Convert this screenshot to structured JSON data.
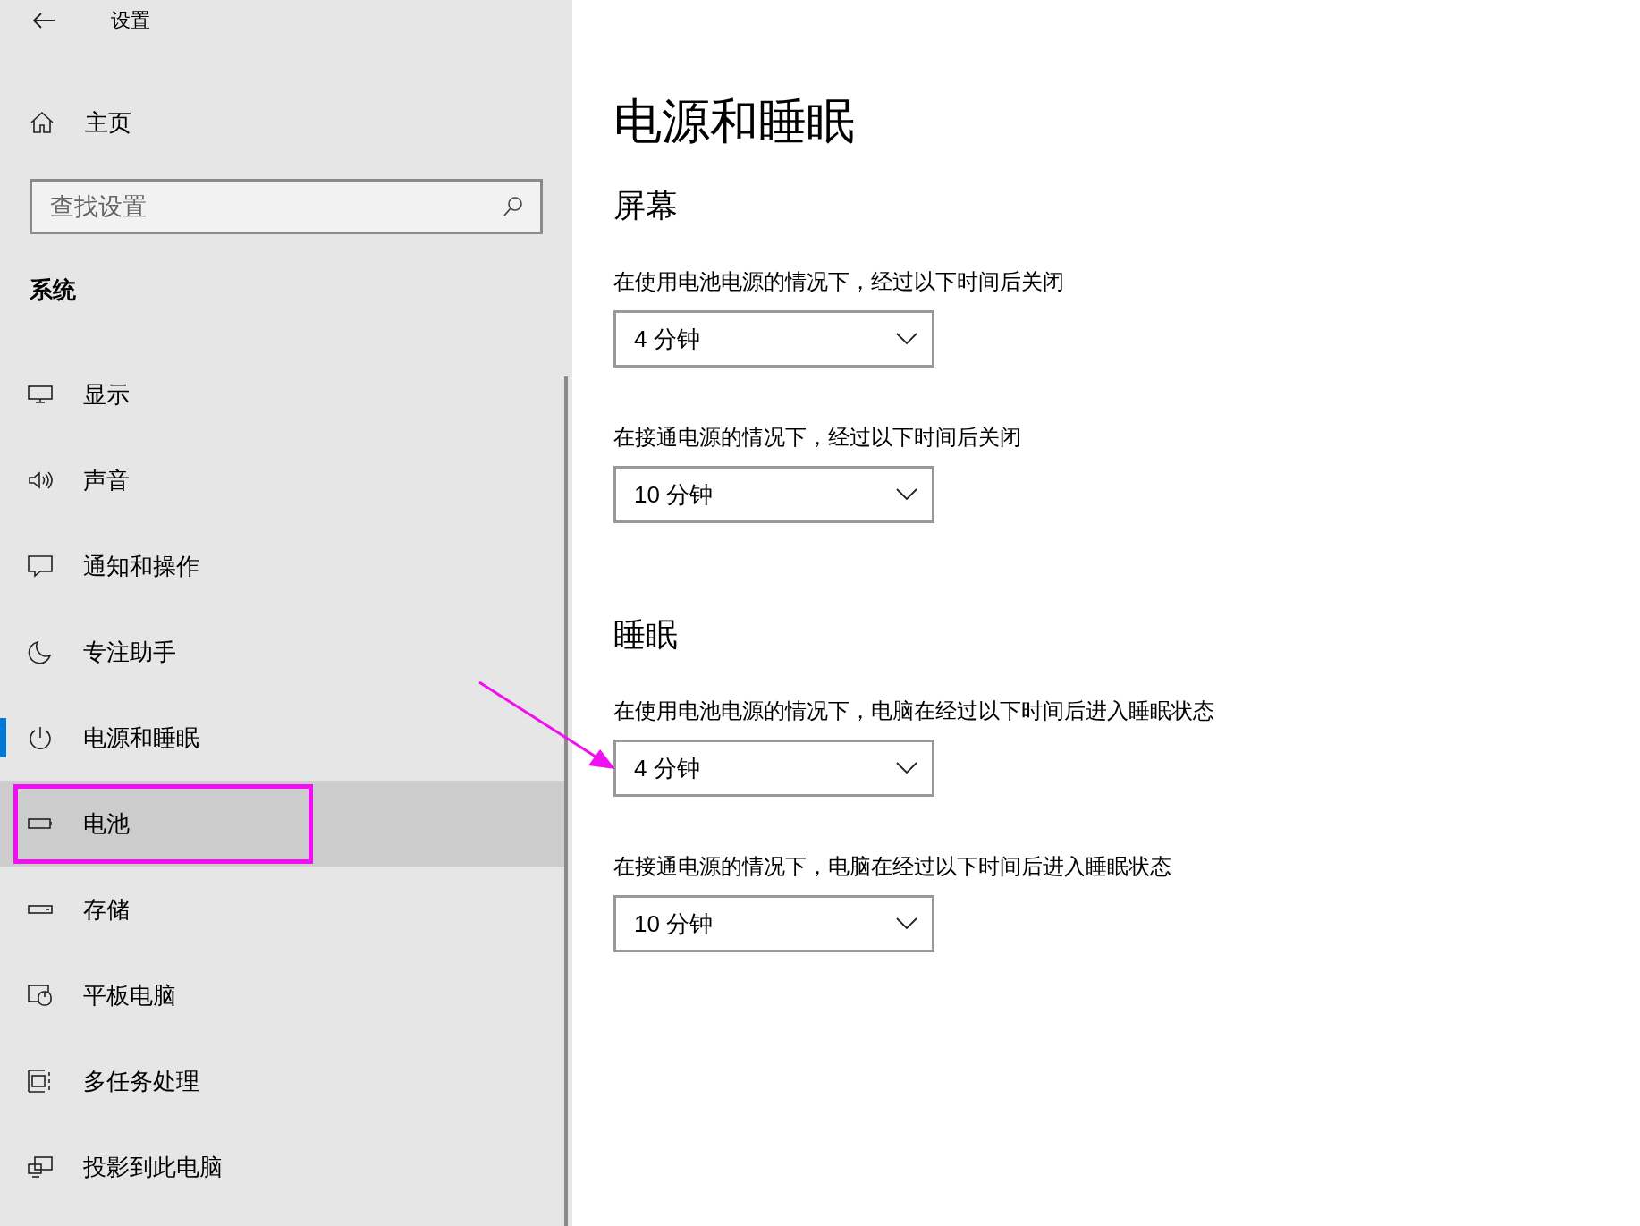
{
  "window": {
    "title": "设置"
  },
  "sidebar": {
    "home": "主页",
    "search": {
      "placeholder": "查找设置"
    },
    "section": "系统",
    "items": [
      {
        "kind": "display",
        "label": "显示",
        "selected": false,
        "hovered": false
      },
      {
        "kind": "sound",
        "label": "声音",
        "selected": false,
        "hovered": false
      },
      {
        "kind": "notify",
        "label": "通知和操作",
        "selected": false,
        "hovered": false
      },
      {
        "kind": "focus",
        "label": "专注助手",
        "selected": false,
        "hovered": false
      },
      {
        "kind": "power",
        "label": "电源和睡眠",
        "selected": true,
        "hovered": false
      },
      {
        "kind": "battery",
        "label": "电池",
        "selected": false,
        "hovered": true
      },
      {
        "kind": "storage",
        "label": "存储",
        "selected": false,
        "hovered": false
      },
      {
        "kind": "tablet",
        "label": "平板电脑",
        "selected": false,
        "hovered": false
      },
      {
        "kind": "multitask",
        "label": "多任务处理",
        "selected": false,
        "hovered": false
      },
      {
        "kind": "project",
        "label": "投影到此电脑",
        "selected": false,
        "hovered": false
      }
    ]
  },
  "page": {
    "title": "电源和睡眠",
    "sections": [
      {
        "heading": "屏幕",
        "settings": [
          {
            "label": "在使用电池电源的情况下，经过以下时间后关闭",
            "value": "4 分钟"
          },
          {
            "label": "在接通电源的情况下，经过以下时间后关闭",
            "value": "10 分钟"
          }
        ]
      },
      {
        "heading": "睡眠",
        "settings": [
          {
            "label": "在使用电池电源的情况下，电脑在经过以下时间后进入睡眠状态",
            "value": "4 分钟"
          },
          {
            "label": "在接通电源的情况下，电脑在经过以下时间后进入睡眠状态",
            "value": "10 分钟"
          }
        ]
      }
    ]
  }
}
